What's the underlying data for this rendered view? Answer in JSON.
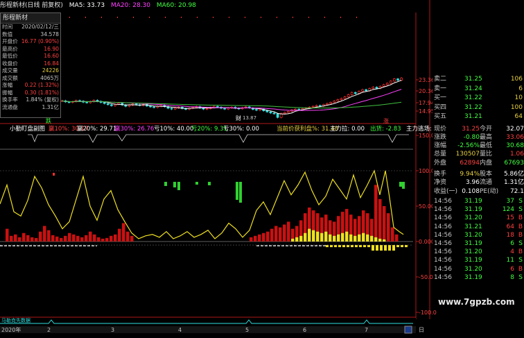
{
  "top_bar": {
    "title": "彤程新材(日线 前复权)",
    "ma5_label": "MA5: 33.73",
    "ma20_label": "MA20: 28.30",
    "ma60_label": "MA60: 20.98"
  },
  "info_box": {
    "header": "彤程新材",
    "rows": [
      {
        "key": "时间",
        "value": "2020/02/12/三",
        "color": "#c8c8c8"
      },
      {
        "key": "数值",
        "value": "34.578",
        "color": "#c8c8c8"
      },
      {
        "key": "开盘价",
        "value": "16.77 (0.90%)",
        "color": "#ff4040"
      },
      {
        "key": "最高价",
        "value": "16.90",
        "color": "#ff4040"
      },
      {
        "key": "最低价",
        "value": "16.60",
        "color": "#ff4040"
      },
      {
        "key": "收盘价",
        "value": "16.84",
        "color": "#ff4040"
      },
      {
        "key": "成交量",
        "value": "24226",
        "color": "#e8d040"
      },
      {
        "key": "成交额",
        "value": "4065万",
        "color": "#c8c8c8"
      },
      {
        "key": "涨幅",
        "value": "0.22 (1.32%)",
        "color": "#ff4040"
      },
      {
        "key": "振幅",
        "value": "0.30 (1.81%)",
        "color": "#ff4040"
      },
      {
        "key": "换手率",
        "value": "1.84% (复权)",
        "color": "#c8c8c8"
      },
      {
        "key": "流通盘",
        "value": "1.31亿",
        "color": "#c8c8c8"
      }
    ]
  },
  "price_axis": [
    "23.36",
    "20.36",
    "17.94",
    "14.95"
  ],
  "markers": {
    "die": "跌",
    "zhang": "涨",
    "cai": "财",
    "low_value": "13.87"
  },
  "indicator_bar": {
    "name": "小勤盯盘副图",
    "items": [
      {
        "text": "赢10%: 30.17",
        "color": "#ff4040"
      },
      {
        "text": "赢20%: 29.71",
        "color": "#ffffff"
      },
      {
        "text": "赢30%: 26.76",
        "color": "#ff40ff"
      },
      {
        "text": "亏10%: 40.00",
        "color": "#ffffff"
      },
      {
        "text": "亏20%: 9.31",
        "color": "#40ff40"
      },
      {
        "text": "亏30%: 0.00",
        "color": "#ffffff"
      },
      {
        "text": "当前价获利盘%: 31.48",
        "color": "#e8d040"
      },
      {
        "text": "主力拉: 0.00",
        "color": "#ffffff"
      },
      {
        "text": "出货: -2.83",
        "color": "#40ff40"
      },
      {
        "text": "主力逃场: -1",
        "color": "#ffffff"
      }
    ]
  },
  "indicator_axis": [
    "150.0",
    "100.0",
    "50.00",
    "0.000",
    "-50.00",
    "-100.0"
  ],
  "right_panel": {
    "ask_rows": [
      {
        "label": "卖二",
        "price": "31.25",
        "vol": "106"
      },
      {
        "label": "卖一",
        "price": "31.24",
        "vol": "6"
      },
      {
        "label": "买一",
        "price": "31.22",
        "vol": "10"
      },
      {
        "label": "买四",
        "price": "31.22",
        "vol": "100"
      },
      {
        "label": "买五",
        "price": "31.21",
        "vol": "64"
      }
    ],
    "stats": [
      {
        "k1": "现价",
        "v1": "31.25",
        "c1": "#ff4040",
        "k2": "今开",
        "v2": "32.07",
        "c2": "#ffffff"
      },
      {
        "k1": "涨跌",
        "v1": "-0.80",
        "c1": "#40ff40",
        "k2": "最高",
        "v2": "33.06",
        "c2": "#ff4040"
      },
      {
        "k1": "涨幅",
        "v1": "-2.56%",
        "c1": "#40ff40",
        "k2": "最低",
        "v2": "30.68",
        "c2": "#40ff40"
      },
      {
        "k1": "总量",
        "v1": "130507",
        "c1": "#e8d040",
        "k2": "量比",
        "v2": "1.06",
        "c2": "#ff4040"
      },
      {
        "k1": "外盘",
        "v1": "62894",
        "c1": "#ff4040",
        "k2": "内盘",
        "v2": "67693",
        "c2": "#40ff40"
      }
    ],
    "stats2": [
      {
        "k1": "换手",
        "v1": "9.94%",
        "c1": "#e8d040",
        "k2": "股本",
        "v2": "5.86亿",
        "c2": "#ffffff"
      },
      {
        "k1": "净资",
        "v1": "3.96",
        "c1": "#ffffff",
        "k2": "流通",
        "v2": "1.31亿",
        "c2": "#ffffff"
      },
      {
        "k1": "收益(一)",
        "v1": "0.108",
        "c1": "#ffffff",
        "k2": "PE(动)",
        "v2": "72.1",
        "c2": "#ffffff"
      }
    ],
    "ticks": [
      {
        "time": "14:56",
        "price": "31.19",
        "vol": "37",
        "flag": "S",
        "vc": "#40ff40"
      },
      {
        "time": "14:56",
        "price": "31.19",
        "vol": "124",
        "flag": "S",
        "vc": "#40ff40"
      },
      {
        "time": "14:56",
        "price": "31.20",
        "vol": "15",
        "flag": "B",
        "vc": "#ff4040"
      },
      {
        "time": "14:56",
        "price": "31.21",
        "vol": "64",
        "flag": "B",
        "vc": "#ff4040"
      },
      {
        "time": "14:56",
        "price": "31.20",
        "vol": "18",
        "flag": "B",
        "vc": "#ff4040"
      },
      {
        "time": "14:56",
        "price": "31.19",
        "vol": "6",
        "flag": "S",
        "vc": "#40ff40"
      },
      {
        "time": "14:56",
        "price": "31.20",
        "vol": "4",
        "flag": "B",
        "vc": "#ff4040"
      },
      {
        "time": "14:56",
        "price": "31.19",
        "vol": "11",
        "flag": "S",
        "vc": "#40ff40"
      },
      {
        "time": "14:56",
        "price": "31.20",
        "vol": "6",
        "flag": "B",
        "vc": "#ff4040"
      },
      {
        "time": "14:56",
        "price": "31.19",
        "vol": "8",
        "flag": "S",
        "vc": "#40ff40"
      }
    ]
  },
  "bottom": {
    "label": "马勒克先数据",
    "year": "2020年",
    "month_ticks": [
      "2",
      "3",
      "4",
      "5",
      "6",
      "7"
    ],
    "corner": "日"
  },
  "watermark": "www.7gpzb.com",
  "chart_data": {
    "type": "line",
    "price_closes": [
      20.2,
      19.8,
      19.6,
      19.9,
      20.3,
      20.1,
      19.7,
      19.5,
      19.9,
      20.4,
      20.0,
      19.6,
      19.2,
      18.8,
      18.4,
      18.9,
      19.3,
      18.7,
      18.2,
      18.6,
      19.1,
      18.8,
      18.5,
      18.9,
      18.3,
      18.0,
      17.8,
      18.2,
      18.6,
      18.1,
      17.5,
      17.2,
      17.6,
      17.9,
      17.4,
      17.1,
      17.5,
      17.8,
      18.1,
      17.6,
      17.2,
      17.4,
      17.8,
      18.2,
      17.9,
      17.5,
      17.2,
      17.6,
      17.9,
      17.5,
      17.3,
      17.7,
      18.0,
      17.6,
      17.1,
      16.8,
      17.2,
      16.6,
      16.2,
      15.8,
      15.5,
      14.2,
      15.6,
      16.0,
      16.4,
      16.9,
      17.2,
      17.0,
      17.4,
      17.6,
      17.9,
      18.2,
      18.5,
      18.3,
      18.8,
      19.2,
      19.6,
      20.1,
      20.6,
      21.0,
      21.6,
      22.4,
      23.2,
      22.8,
      23.6,
      24.2,
      23.8,
      24.6,
      25.1,
      24.7,
      25.4,
      26.0,
      26.5,
      27.3,
      28.1,
      27.6,
      28.4
    ],
    "indicator_axis_range": [
      -100,
      150
    ]
  }
}
